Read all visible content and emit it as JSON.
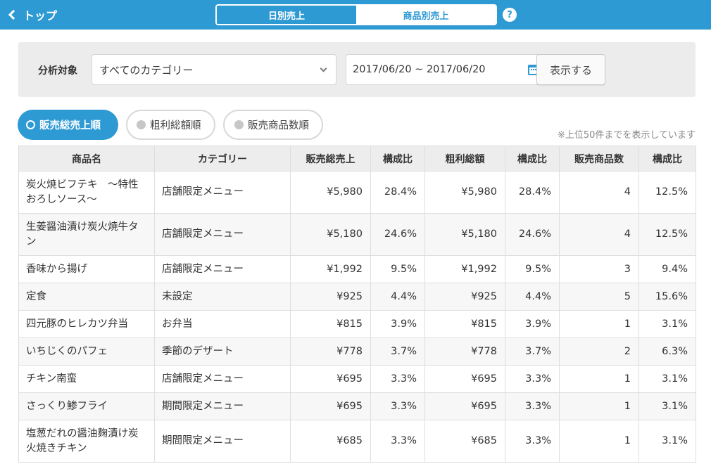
{
  "header": {
    "back_label": "トップ",
    "tabs": [
      {
        "label": "日別売上",
        "active": false
      },
      {
        "label": "商品別売上",
        "active": true
      }
    ],
    "help_label": "?"
  },
  "filter": {
    "label": "分析対象",
    "category_value": "すべてのカテゴリー",
    "date_range": "2017/06/20 ~ 2017/06/20",
    "submit_label": "表示する"
  },
  "sort": {
    "options": [
      {
        "label": "販売総売上順",
        "active": true
      },
      {
        "label": "粗利総額順",
        "active": false
      },
      {
        "label": "販売商品数順",
        "active": false
      }
    ],
    "note": "※上位50件までを表示しています"
  },
  "table": {
    "columns": [
      "商品名",
      "カテゴリー",
      "販売総売上",
      "構成比",
      "粗利総額",
      "構成比",
      "販売商品数",
      "構成比"
    ],
    "rows": [
      [
        "炭火焼ビフテキ　〜特性おろしソース〜",
        "店舗限定メニュー",
        "¥5,980",
        "28.4%",
        "¥5,980",
        "28.4%",
        "4",
        "12.5%"
      ],
      [
        "生姜醤油漬け炭火焼牛タン",
        "店舗限定メニュー",
        "¥5,180",
        "24.6%",
        "¥5,180",
        "24.6%",
        "4",
        "12.5%"
      ],
      [
        "香味から揚げ",
        "店舗限定メニュー",
        "¥1,992",
        "9.5%",
        "¥1,992",
        "9.5%",
        "3",
        "9.4%"
      ],
      [
        "定食",
        "未設定",
        "¥925",
        "4.4%",
        "¥925",
        "4.4%",
        "5",
        "15.6%"
      ],
      [
        "四元豚のヒレカツ弁当",
        "お弁当",
        "¥815",
        "3.9%",
        "¥815",
        "3.9%",
        "1",
        "3.1%"
      ],
      [
        "いちじくのパフェ",
        "季節のデザート",
        "¥778",
        "3.7%",
        "¥778",
        "3.7%",
        "2",
        "6.3%"
      ],
      [
        "チキン南蛮",
        "店舗限定メニュー",
        "¥695",
        "3.3%",
        "¥695",
        "3.3%",
        "1",
        "3.1%"
      ],
      [
        "さっくり鯵フライ",
        "期間限定メニュー",
        "¥695",
        "3.3%",
        "¥695",
        "3.3%",
        "1",
        "3.1%"
      ],
      [
        "塩葱だれの醤油麹漬け炭火焼きチキン",
        "期間限定メニュー",
        "¥685",
        "3.3%",
        "¥685",
        "3.3%",
        "1",
        "3.1%"
      ]
    ]
  },
  "colors": {
    "accent": "#2e9ad4",
    "panel_bg": "#ececec",
    "header_bg": "#ededed"
  }
}
